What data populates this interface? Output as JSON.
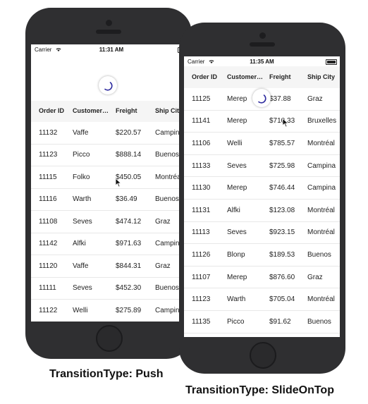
{
  "left_device": {
    "status": {
      "carrier": "Carrier",
      "time": "11:31 AM"
    },
    "columns": [
      "Order ID",
      "Customer…",
      "Freight",
      "Ship City"
    ],
    "rows": [
      [
        "11132",
        "Vaffe",
        "$220.57",
        "Campina"
      ],
      [
        "11123",
        "Picco",
        "$888.14",
        "Buenos"
      ],
      [
        "11115",
        "Folko",
        "$450.05",
        "Montréal"
      ],
      [
        "11116",
        "Warth",
        "$36.49",
        "Buenos"
      ],
      [
        "11108",
        "Seves",
        "$474.12",
        "Graz"
      ],
      [
        "11142",
        "Alfki",
        "$971.63",
        "Campina"
      ],
      [
        "11120",
        "Vaffe",
        "$844.31",
        "Graz"
      ],
      [
        "11111",
        "Seves",
        "$452.30",
        "Buenos"
      ],
      [
        "11122",
        "Welli",
        "$275.89",
        "Campina"
      ]
    ],
    "caption": "TransitionType: Push"
  },
  "right_device": {
    "status": {
      "carrier": "Carrier",
      "time": "11:35 AM"
    },
    "columns": [
      "Order ID",
      "Customer…",
      "Freight",
      "Ship City"
    ],
    "rows": [
      [
        "11125",
        "Merep",
        "$37.88",
        "Graz"
      ],
      [
        "11141",
        "Merep",
        "$710.33",
        "Bruxelles"
      ],
      [
        "11106",
        "Welli",
        "$785.57",
        "Montréal"
      ],
      [
        "11133",
        "Seves",
        "$725.98",
        "Campina"
      ],
      [
        "11130",
        "Merep",
        "$746.44",
        "Campina"
      ],
      [
        "11131",
        "Alfki",
        "$123.08",
        "Montréal"
      ],
      [
        "11113",
        "Seves",
        "$923.15",
        "Montréal"
      ],
      [
        "11126",
        "Blonp",
        "$189.53",
        "Buenos"
      ],
      [
        "11107",
        "Merep",
        "$876.60",
        "Graz"
      ],
      [
        "11123",
        "Warth",
        "$705.04",
        "Montréal"
      ],
      [
        "11135",
        "Picco",
        "$91.62",
        "Buenos"
      ]
    ],
    "caption": "TransitionType: SlideOnTop"
  },
  "colors": {
    "phone_body": "#2f2f31",
    "spinner_arc": "#2d2a9e",
    "header_bg": "#f5f5f5"
  },
  "icons": [
    "wifi-icon",
    "battery-icon",
    "loading-spinner-icon",
    "mouse-cursor-icon"
  ]
}
